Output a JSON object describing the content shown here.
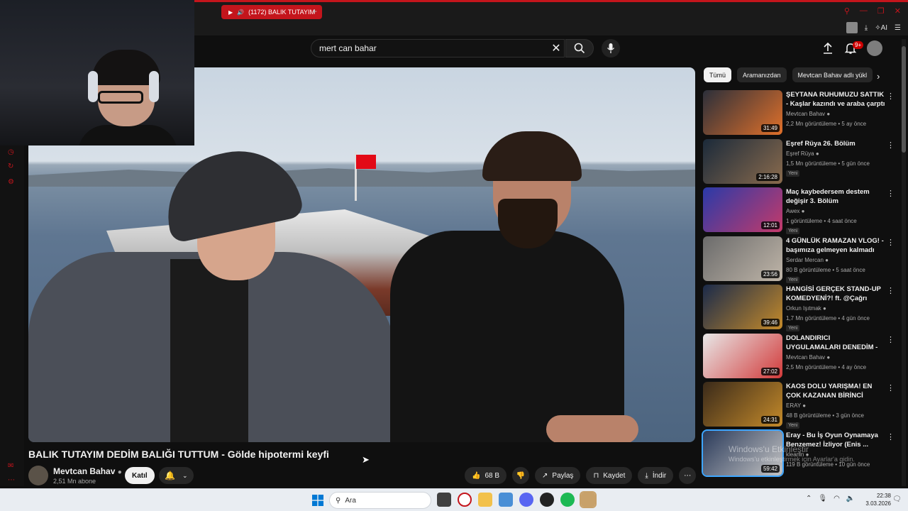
{
  "browser": {
    "tab_title": "(1172) BALIK TUTAYIM",
    "new_tab_label": "+",
    "tools_ai_label": "AI"
  },
  "header": {
    "search_value": "mert can bahar",
    "notification_count": "9+"
  },
  "video": {
    "title": "BALIK TUTAYIM DEDİM BALIĞI TUTTUM - Gölde hipotermi keyfi",
    "channel_name": "Mevtcan Bahav",
    "subscribers": "2,51 Mn abone",
    "join_label": "Katıl",
    "likes": "68 B",
    "share_label": "Paylaş",
    "save_label": "Kaydet",
    "download_label": "İndir"
  },
  "chips": [
    "Tümü",
    "Aramanızdan",
    "Mevtcan Bahav adlı yükl"
  ],
  "recommendations": [
    {
      "title": "ŞEYTANA RUHUMUZU SATTIK - Kaşlar kazındı ve araba çarptı ...",
      "channel": "Mevtcan Bahav",
      "meta": "2,2 Mn görüntüleme • 5 ay önce",
      "duration": "31:49",
      "is_new": false,
      "new_label": "",
      "colors": [
        "#2b2f3a",
        "#e0702a"
      ]
    },
    {
      "title": "Eşref Rüya 26. Bölüm",
      "channel": "Eşref Rüya",
      "meta": "1,5 Mn görüntüleme • 5 gün önce",
      "duration": "2:16:28",
      "is_new": true,
      "new_label": "Yeni",
      "colors": [
        "#1b2a3a",
        "#8a6b4d"
      ]
    },
    {
      "title": "Maç kaybedersem destem değişir 3. Bölüm",
      "channel": "Awex",
      "meta": "1 görüntüleme • 4 saat önce",
      "duration": "12:01",
      "is_new": true,
      "new_label": "Yeni",
      "colors": [
        "#2a3aa8",
        "#c43a6a"
      ]
    },
    {
      "title": "4 GÜNLÜK RAMAZAN VLOG! - başımıza gelmeyen kalmadı",
      "channel": "Serdar Mercan",
      "meta": "80 B görüntüleme • 5 saat önce",
      "duration": "23:56",
      "is_new": true,
      "new_label": "Yeni",
      "colors": [
        "#6b6b6b",
        "#bfb5a8"
      ]
    },
    {
      "title": "HANGİSİ GERÇEK STAND-UP KOMEDYENİ?! ft. @Çağrı Ergün",
      "channel": "Orkun Işıtmak",
      "meta": "1,7 Mn görüntüleme • 4 gün önce",
      "duration": "39:46",
      "is_new": true,
      "new_label": "Yeni",
      "colors": [
        "#1a2a4a",
        "#c48a2a"
      ]
    },
    {
      "title": "DOLANDIRICI UYGULAMALARI DENEDİM - Ocağımız söndü",
      "channel": "Mevtcan Bahav",
      "meta": "2,5 Mn görüntüleme • 4 ay önce",
      "duration": "27:02",
      "is_new": false,
      "new_label": "",
      "colors": [
        "#e8e8e8",
        "#d23a3a"
      ]
    },
    {
      "title": "KAOS DOLU YARIŞMA! EN ÇOK KAZANAN BİRİNCİ OLUR! | ...",
      "channel": "ERAY",
      "meta": "48 B görüntüleme • 3 gün önce",
      "duration": "24:31",
      "is_new": true,
      "new_label": "Yeni",
      "colors": [
        "#3a2a1a",
        "#c48a2a"
      ]
    },
    {
      "title": "Eray - Bu İş Oyun Oynamaya Benzemez! İzliyor (Enis ...",
      "channel": "kleanin",
      "meta": "119 B görüntüleme • 10 gün önce",
      "duration": "59:42",
      "is_new": false,
      "new_label": "",
      "colors": [
        "#2a3a5a",
        "#c4c4c4"
      ]
    }
  ],
  "watermark": {
    "line1": "Windows'u Etkinleştir",
    "line2": "Windows'u etkinleştirmek için Ayarlar'a gidin."
  },
  "taskbar": {
    "search_placeholder": "Ara",
    "time": "22:38",
    "date": "3.03.2026"
  },
  "icons": {
    "accent": "#c4151c",
    "yt_red": "#cc0000"
  }
}
